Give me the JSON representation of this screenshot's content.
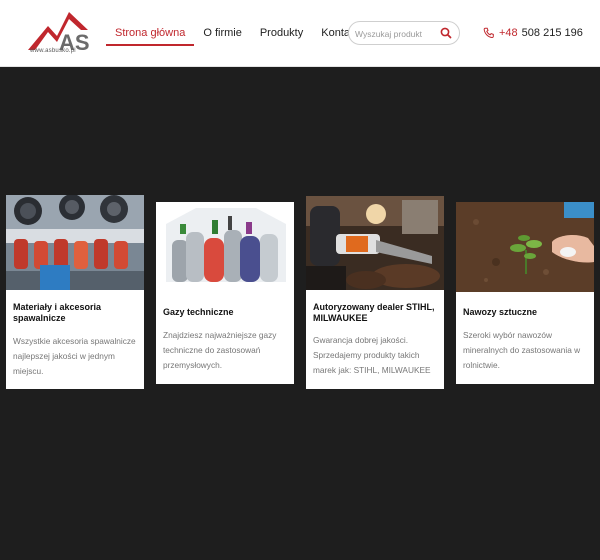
{
  "header": {
    "logo_text": "AS",
    "logo_url_text": "www.asbusko.pl",
    "nav": [
      {
        "label": "Strona główna",
        "active": true
      },
      {
        "label": "O firmie",
        "active": false
      },
      {
        "label": "Produkty",
        "active": false
      },
      {
        "label": "Kontakt",
        "active": false
      }
    ],
    "search_placeholder": "Wyszukaj produkt",
    "phone_prefix": "+48",
    "phone_number": "508 215 196"
  },
  "colors": {
    "accent": "#c0272d",
    "background": "#1e1e1e"
  },
  "cards": [
    {
      "icon": "welding-accessories-photo",
      "title_line1": "Materiały i akcesoria",
      "title_line2": "spawalnicze",
      "text_lines": [
        "Wszystkie akcesoria spawalnicze",
        "najlepszej jakości w jednym",
        "miejscu."
      ]
    },
    {
      "icon": "gas-cylinders-photo",
      "title_line1": "Gazy techniczne",
      "title_line2": "",
      "text_lines": [
        "Znajdziesz najważniejsze gazy",
        "techniczne do zastosowań",
        "przemysłowych."
      ]
    },
    {
      "icon": "chainsaw-photo",
      "title_line1": "Autoryzowany dealer STIHL,",
      "title_line2": "MILWAUKEE",
      "text_lines": [
        "Gwarancja dobrej jakości.",
        "Sprzedajemy produkty takich",
        "marek jak: STIHL, MILWAUKEE"
      ]
    },
    {
      "icon": "fertilizer-photo",
      "title_line1": "Nawozy sztuczne",
      "title_line2": "",
      "text_lines": [
        "Szeroki wybór nawozów",
        "mineralnych do zastosowania w",
        "rolnictwie."
      ]
    }
  ]
}
